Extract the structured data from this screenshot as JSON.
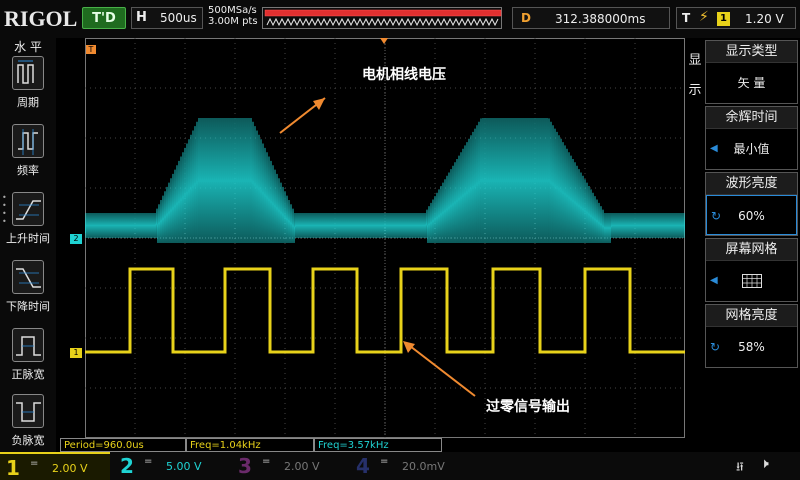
{
  "brand": "RIGOL",
  "status": {
    "trigger_state": "T'D"
  },
  "horizontal": {
    "tag": "H",
    "timebase": "500us"
  },
  "acquisition": {
    "sample_rate": "500MSa/s",
    "memory": "3.00M pts"
  },
  "delay": {
    "tag": "D",
    "value": "312.388000ms"
  },
  "trigger": {
    "tag": "T",
    "edge_icon": "rising-falling-edge-icon",
    "source": "1",
    "level": "1.20 V"
  },
  "left_menu": {
    "title": "水 平",
    "items": [
      {
        "label": "周期",
        "icon": "period-icon"
      },
      {
        "label": "频率",
        "icon": "frequency-icon"
      },
      {
        "label": "上升时间",
        "icon": "rise-time-icon"
      },
      {
        "label": "下降时间",
        "icon": "fall-time-icon"
      },
      {
        "label": "正脉宽",
        "icon": "positive-width-icon"
      },
      {
        "label": "负脉宽",
        "icon": "negative-width-icon"
      }
    ]
  },
  "right_menu": {
    "title_vertical": "显示",
    "items": [
      {
        "title": "显示类型",
        "value": "矢 量"
      },
      {
        "title": "余辉时间",
        "value": "最小值"
      },
      {
        "title": "波形亮度",
        "value": "60%"
      },
      {
        "title": "屏幕网格",
        "value": ""
      },
      {
        "title": "网格亮度",
        "value": "58%"
      }
    ]
  },
  "annotations": {
    "top": "电机相线电压",
    "bottom": "过零信号输出"
  },
  "markers": {
    "ch2": "2",
    "ch1": "1",
    "trig_level": "T",
    "trig_pos": "T"
  },
  "measurements": [
    {
      "label": "Period=960.0us",
      "color": "#e8d21a"
    },
    {
      "label": "Freq=1.04kHz",
      "color": "#e8d21a"
    },
    {
      "label": "Freq=3.57kHz",
      "color": "#1fd3d3"
    }
  ],
  "channels": [
    {
      "num": "1",
      "coupling": "=",
      "scale": "2.00 V",
      "color": "#e8d21a",
      "active": true
    },
    {
      "num": "2",
      "coupling": "=",
      "scale": "5.00 V",
      "color": "#1fd3d3",
      "active": false
    },
    {
      "num": "3",
      "coupling": "=",
      "scale": "2.00 V",
      "color": "#b23ab2",
      "active": false
    },
    {
      "num": "4",
      "coupling": "=",
      "scale": "20.0mV",
      "color": "#3a5ad8",
      "active": false
    }
  ],
  "colors": {
    "ch1": "#e8d21a",
    "ch2": "#1fd3d3",
    "accent": "#f08a30",
    "menu_select": "#2a8bd8"
  }
}
